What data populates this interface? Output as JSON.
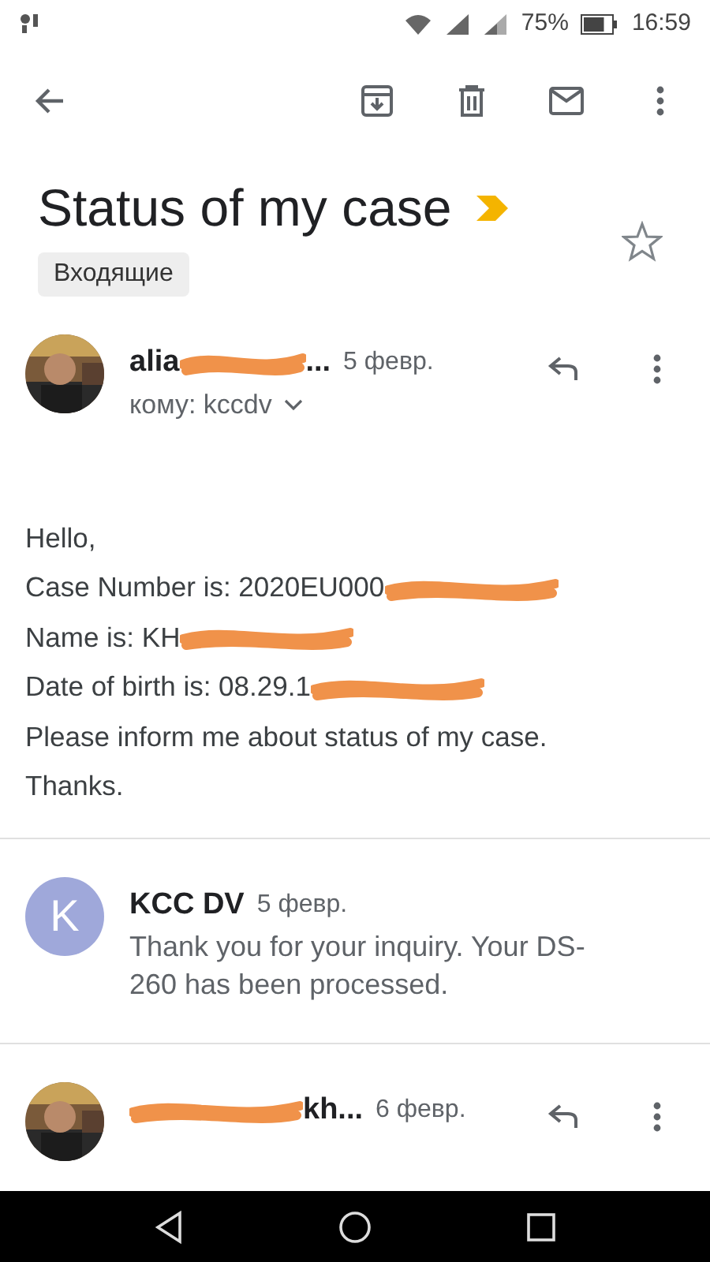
{
  "status_bar": {
    "battery": "75%",
    "time": "16:59"
  },
  "toolbar": {
    "actions": [
      {
        "kind": "archive"
      },
      {
        "kind": "delete"
      },
      {
        "kind": "mail"
      },
      {
        "kind": "more"
      }
    ]
  },
  "subject": {
    "title": "Status of my case",
    "important": true,
    "starred": false,
    "label": "Входящие"
  },
  "messages": [
    {
      "kind": "expanded",
      "sender": "alia",
      "sender_redacted": true,
      "sender_tail": "...",
      "date": "5 февр.",
      "to": "кому: kccdv",
      "body": [
        {
          "text": "Hello,",
          "redacted": false
        },
        {
          "text": "Case Number is: 2020EU000",
          "redacted": true
        },
        {
          "text": "Name is: KH",
          "redacted": true
        },
        {
          "text": "Date of birth is: 08.29.1",
          "redacted": true
        },
        {
          "text": "Please inform me about status of my case.",
          "redacted": false
        },
        {
          "text": "Thanks.",
          "redacted": false
        }
      ]
    },
    {
      "kind": "collapsed",
      "avatar_letter": "K",
      "color": "#9fa8da",
      "sender": "KCC DV",
      "date": "5 февр.",
      "snippet": "Thank you for your inquiry. Your DS-260 has been processed."
    },
    {
      "kind": "cut",
      "sender_redacted": true,
      "sender_tail": "kh...",
      "date": "6 февр."
    }
  ]
}
